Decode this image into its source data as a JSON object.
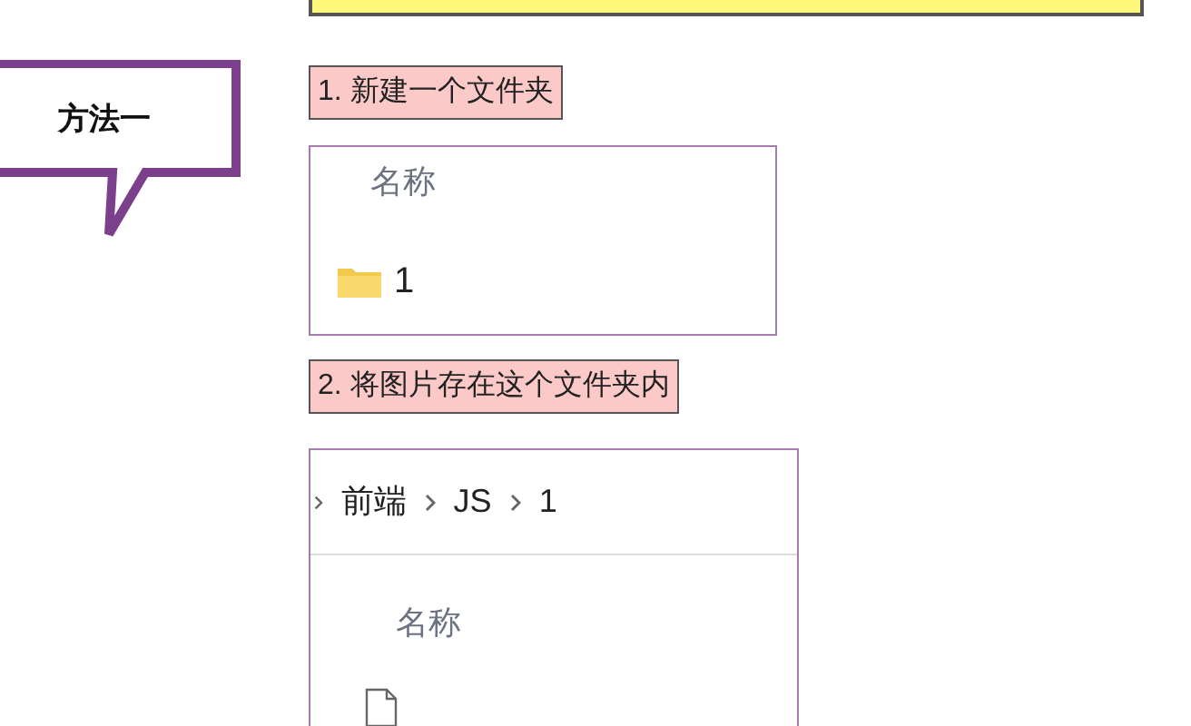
{
  "callout": {
    "label": "方法一"
  },
  "steps": [
    {
      "label": "1. 新建一个文件夹",
      "panel": {
        "column": "名称",
        "items": [
          {
            "kind": "folder",
            "name": "1"
          }
        ]
      }
    },
    {
      "label": "2. 将图片存在这个文件夹内",
      "panel": {
        "breadcrumb": [
          "前端",
          "JS",
          "1"
        ],
        "column": "名称",
        "items": [
          {
            "kind": "file"
          }
        ]
      }
    }
  ]
}
